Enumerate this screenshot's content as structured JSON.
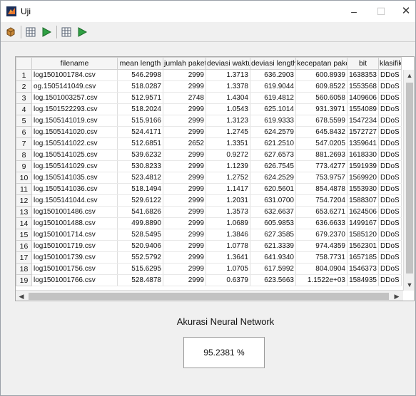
{
  "window": {
    "title": "Uji",
    "minimize": "–",
    "maximize": "☐",
    "close": "✕"
  },
  "toolbar": {
    "icons": [
      "open-icon",
      "grid-icon",
      "run-icon",
      "grid-icon-2",
      "run-icon-2"
    ]
  },
  "table": {
    "columns": [
      "",
      "filename",
      "mean length",
      "jumlah paket",
      "deviasi waktu",
      "deviasi length",
      "kecepatan paket",
      "bit",
      "klasifika"
    ],
    "rows": [
      [
        "1",
        "log1501001784.csv",
        "546.2998",
        "2999",
        "1.3713",
        "636.2903",
        "600.8939",
        "1638353",
        "DDoS"
      ],
      [
        "2",
        "og.1505141049.csv",
        "518.0287",
        "2999",
        "1.3378",
        "619.9044",
        "609.8522",
        "1553568",
        "DDoS"
      ],
      [
        "3",
        "log.1501003257.csv",
        "512.9571",
        "2748",
        "1.4304",
        "619.4812",
        "560.6058",
        "1409606",
        "DDoS"
      ],
      [
        "4",
        "log.1501522293.csv",
        "518.2024",
        "2999",
        "1.0543",
        "625.1014",
        "931.3971",
        "1554089",
        "DDoS"
      ],
      [
        "5",
        "log.1505141019.csv",
        "515.9166",
        "2999",
        "1.3123",
        "619.9333",
        "678.5599",
        "1547234",
        "DDoS"
      ],
      [
        "6",
        "log.1505141020.csv",
        "524.4171",
        "2999",
        "1.2745",
        "624.2579",
        "645.8432",
        "1572727",
        "DDoS"
      ],
      [
        "7",
        "log.1505141022.csv",
        "512.6851",
        "2652",
        "1.3351",
        "621.2510",
        "547.0205",
        "1359641",
        "DDoS"
      ],
      [
        "8",
        "log.1505141025.csv",
        "539.6232",
        "2999",
        "0.9272",
        "627.6573",
        "881.2693",
        "1618330",
        "DDoS"
      ],
      [
        "9",
        "log.1505141029.csv",
        "530.8233",
        "2999",
        "1.1239",
        "626.7545",
        "773.4277",
        "1591939",
        "DDoS"
      ],
      [
        "10",
        "log.1505141035.csv",
        "523.4812",
        "2999",
        "1.2752",
        "624.2529",
        "753.9757",
        "1569920",
        "DDoS"
      ],
      [
        "11",
        "log.1505141036.csv",
        "518.1494",
        "2999",
        "1.1417",
        "620.5601",
        "854.4878",
        "1553930",
        "DDoS"
      ],
      [
        "12",
        "log.1505141044.csv",
        "529.6122",
        "2999",
        "1.2031",
        "631.0700",
        "754.7204",
        "1588307",
        "DDoS"
      ],
      [
        "13",
        "log1501001486.csv",
        "541.6826",
        "2999",
        "1.3573",
        "632.6637",
        "653.6271",
        "1624506",
        "DDoS"
      ],
      [
        "14",
        "log1501001488.csv",
        "499.8890",
        "2999",
        "1.0689",
        "605.9853",
        "636.6633",
        "1499167",
        "DDoS"
      ],
      [
        "15",
        "log1501001714.csv",
        "528.5495",
        "2999",
        "1.3846",
        "627.3585",
        "679.2370",
        "1585120",
        "DDoS"
      ],
      [
        "16",
        "log1501001719.csv",
        "520.9406",
        "2999",
        "1.0778",
        "621.3339",
        "974.4359",
        "1562301",
        "DDoS"
      ],
      [
        "17",
        "log1501001739.csv",
        "552.5792",
        "2999",
        "1.3641",
        "641.9340",
        "758.7731",
        "1657185",
        "DDoS"
      ],
      [
        "18",
        "log1501001756.csv",
        "515.6295",
        "2999",
        "1.0705",
        "617.5992",
        "804.0904",
        "1546373",
        "DDoS"
      ],
      [
        "19",
        "log1501001766.csv",
        "528.4878",
        "2999",
        "0.6379",
        "623.5663",
        "1.1522e+03",
        "1584935",
        "DDoS"
      ]
    ]
  },
  "result": {
    "label": "Akurasi Neural Network",
    "value": "95.2381 %"
  }
}
